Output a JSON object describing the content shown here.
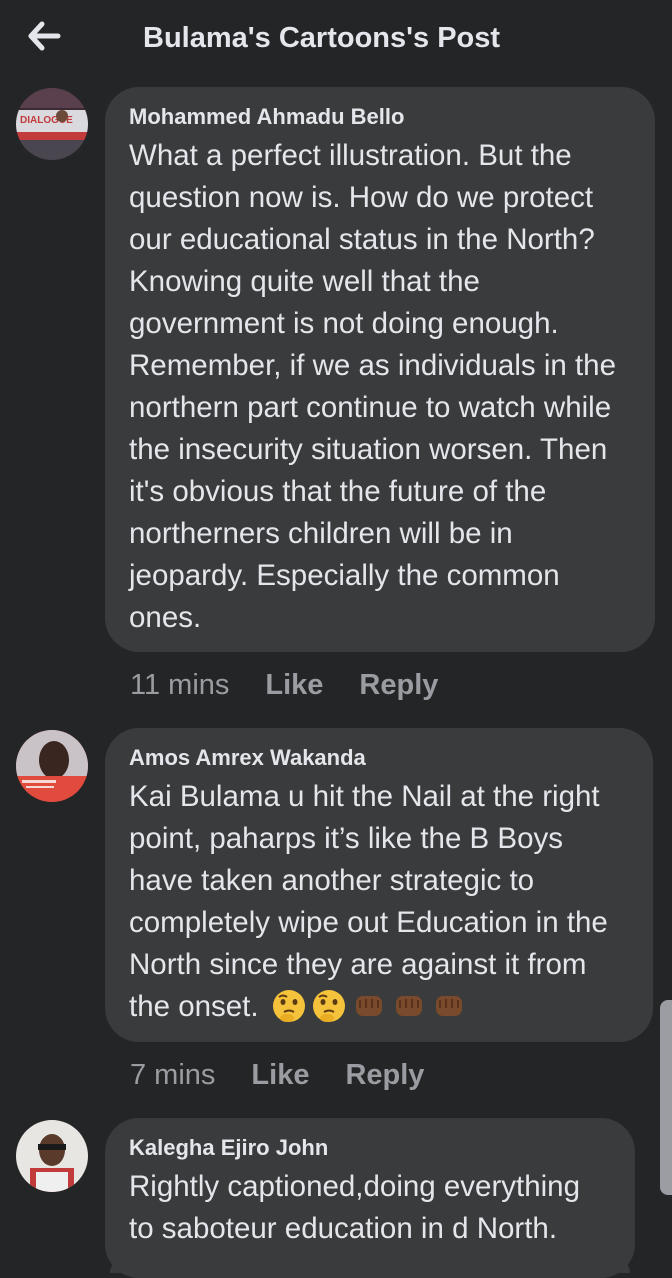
{
  "header": {
    "title": "Bulama's Cartoons's Post",
    "back_icon": "arrow-left-icon"
  },
  "comments": [
    {
      "author": "Mohammed Ahmadu Bello",
      "avatar_text": "DIALOGUE",
      "text": "What a perfect illustration. But the question now is. How do we protect our educational status in the North? Knowing quite well that the government is not doing enough. Remember, if we as individuals in the northern part continue to watch while the insecurity situation worsen. Then it's obvious that the future of the northerners children will be in jeopardy. Especially the common ones.",
      "time": "11 mins",
      "like": "Like",
      "reply": "Reply"
    },
    {
      "author": "Amos Amrex Wakanda",
      "text": "Kai Bulama u hit the Nail at the right point, paharps it’s like the B Boys have taken another strategic to completely wipe out Education in the North since they are against it from the onset.",
      "emojis": [
        "thinking-face-icon",
        "thinking-face-icon",
        "fist-icon",
        "fist-icon",
        "fist-icon"
      ],
      "time": "7 mins",
      "like": "Like",
      "reply": "Reply"
    },
    {
      "author": "Kalegha Ejiro John",
      "text": "Rightly captioned,doing everything to saboteur education in d North."
    }
  ],
  "colors": {
    "background": "#242526",
    "bubble": "#3a3b3c",
    "text": "#e4e6eb",
    "secondary": "#9a9ca1"
  }
}
